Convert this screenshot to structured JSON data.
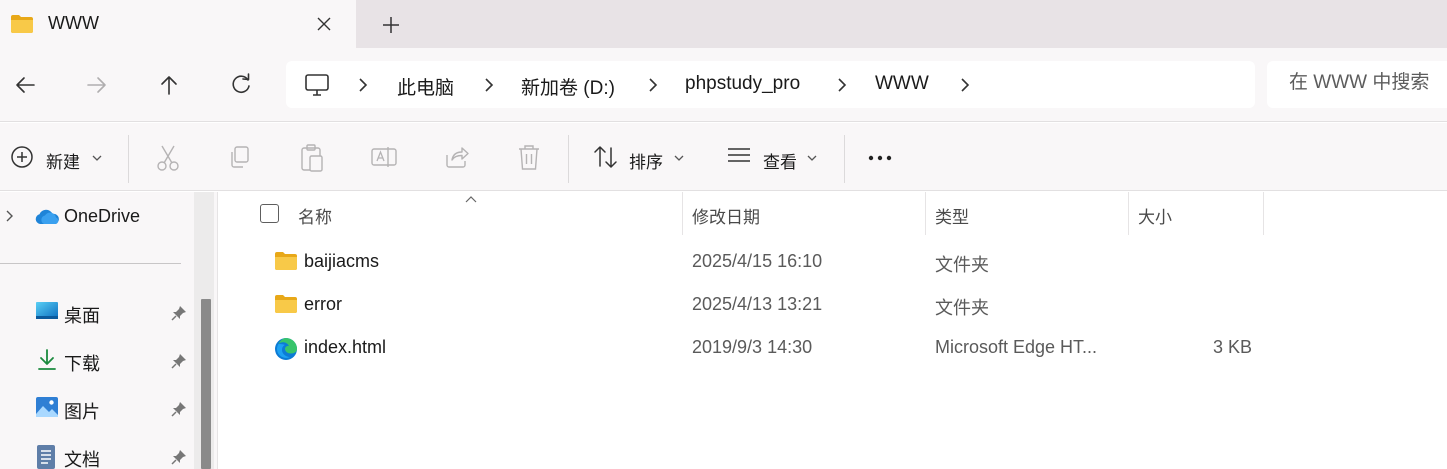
{
  "window": {
    "tab_title": "WWW"
  },
  "address": {
    "crumbs": [
      "此电脑",
      "新加卷 (D:)",
      "phpstudy_pro",
      "WWW"
    ],
    "search_placeholder": "在 WWW 中搜索"
  },
  "toolbar": {
    "new_label": "新建",
    "sort_label": "排序",
    "view_label": "查看"
  },
  "sidebar": {
    "onedrive_label": "OneDrive",
    "items": [
      {
        "label": "桌面",
        "icon": "desktop-icon"
      },
      {
        "label": "下载",
        "icon": "download-icon"
      },
      {
        "label": "图片",
        "icon": "pictures-icon"
      },
      {
        "label": "文档",
        "icon": "documents-icon"
      }
    ]
  },
  "filelist": {
    "columns": {
      "name": "名称",
      "date": "修改日期",
      "type": "类型",
      "size": "大小"
    },
    "rows": [
      {
        "name": "baijiacms",
        "date": "2025/4/15 16:10",
        "type": "文件夹",
        "size": "",
        "icon": "folder-icon"
      },
      {
        "name": "error",
        "date": "2025/4/13 13:21",
        "type": "文件夹",
        "size": "",
        "icon": "folder-icon"
      },
      {
        "name": "index.html",
        "date": "2019/9/3 14:30",
        "type": "Microsoft Edge HT...",
        "size": "3 KB",
        "icon": "edge-icon"
      }
    ]
  },
  "colors": {
    "accent_blue": "#0f6cbd",
    "folder_yellow": "#f4c43e"
  }
}
